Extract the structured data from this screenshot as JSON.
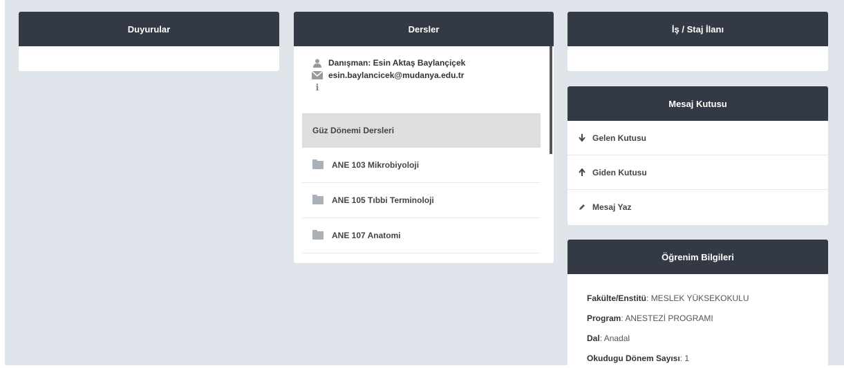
{
  "panels": {
    "duyurular": {
      "title": "Duyurular"
    },
    "dersler": {
      "title": "Dersler",
      "advisor": {
        "name_line": "Danışman: Esin Aktaş Baylançiçek",
        "email": "esin.baylancicek@mudanya.edu.tr",
        "icons": [
          "user-icon",
          "envelope-icon",
          "info-icon"
        ]
      },
      "section_title": "Güz Dönemi Dersleri",
      "courses": [
        "ANE 103 Mikrobiyoloji",
        "ANE 105 Tıbbi Terminoloji",
        "ANE 107 Anatomi"
      ]
    },
    "is_staj": {
      "title": "İş / Staj İlanı"
    },
    "mesaj": {
      "title": "Mesaj Kutusu",
      "items": [
        {
          "label": "Gelen Kutusu",
          "icon": "arrow-down-icon"
        },
        {
          "label": "Giden Kutusu",
          "icon": "arrow-up-icon"
        },
        {
          "label": "Mesaj Yaz",
          "icon": "pencil-icon"
        }
      ]
    },
    "ogrenim": {
      "title": "Öğrenim Bilgileri",
      "fields": [
        {
          "label": "Fakülte/Enstitü",
          "value": "MESLEK YÜKSEKOKULU"
        },
        {
          "label": "Program",
          "value": "ANESTEZİ PROGRAMI"
        },
        {
          "label": "Dal",
          "value": "Anadal"
        },
        {
          "label": "Okudugu Dönem Sayısı",
          "value": "1"
        }
      ]
    }
  },
  "colors": {
    "header_bg": "#343a45",
    "page_bg": "#dfe3ea",
    "section_bg": "#dedede"
  }
}
